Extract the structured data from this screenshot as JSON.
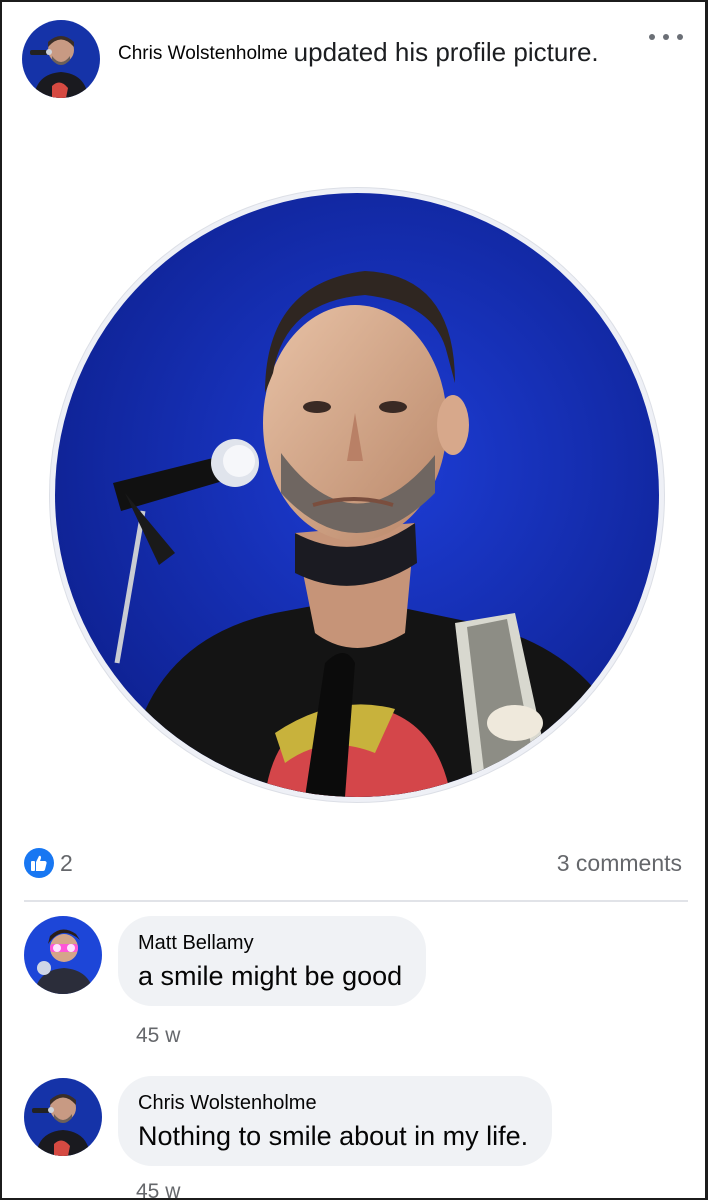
{
  "post": {
    "author": "Chris Wolstenholme",
    "action": "updated his profile picture.",
    "more_icon": "more-horizontal-icon"
  },
  "reactions": {
    "like_icon": "thumbs-up-icon",
    "like_count": "2",
    "comments_count": "3 comments",
    "accent_color": "#1877f2"
  },
  "comments": [
    {
      "author": "Matt Bellamy",
      "text": "a smile might be good",
      "time": "45 w"
    },
    {
      "author": "Chris Wolstenholme",
      "text": "Nothing to smile about in my life.",
      "time": "45 w"
    }
  ]
}
